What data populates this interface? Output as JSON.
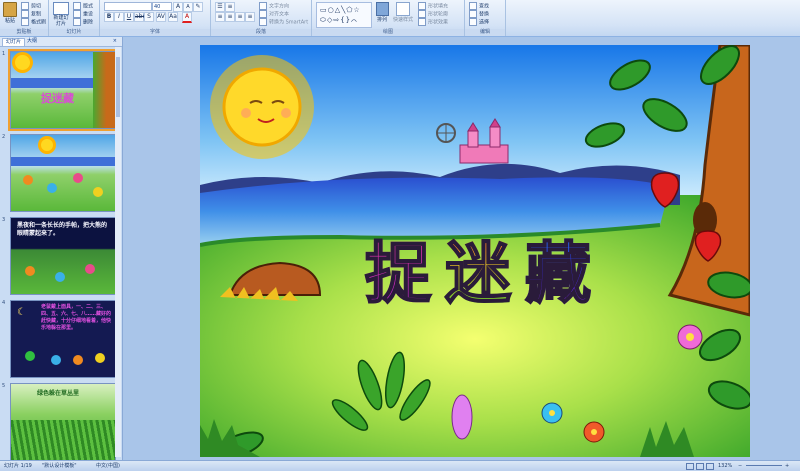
{
  "ribbon": {
    "clipboard": {
      "paste": "粘贴",
      "cut": "剪切",
      "copy": "复制",
      "format_painter": "格式刷",
      "label": "剪贴板"
    },
    "slides": {
      "new_slide": "新建幻灯片",
      "layout": "版式",
      "reset": "重设",
      "delete": "删除",
      "label": "幻灯片"
    },
    "font": {
      "size_value": "40",
      "label": "字体"
    },
    "paragraph": {
      "text_direction": "文字方向",
      "align_text": "对齐文本",
      "convert_smartart": "转换为 SmartArt",
      "label": "段落"
    },
    "drawing": {
      "arrange": "排列",
      "quick_styles": "快速样式",
      "shape_fill": "形状填充",
      "shape_outline": "形状轮廓",
      "shape_effects": "形状效果",
      "label": "绘图"
    },
    "editing": {
      "find": "查找",
      "replace": "替换",
      "select": "选择",
      "label": "编辑"
    }
  },
  "panel": {
    "tabs": [
      "幻灯片",
      "大纲"
    ],
    "close": "×",
    "slides": [
      {
        "num": "1",
        "title": "捉迷藏"
      },
      {
        "num": "2"
      },
      {
        "num": "3",
        "text": "黑夜和一条长长的手帕，把大熊的眼睛蒙起来了。"
      },
      {
        "num": "4",
        "text": "老鼠戴上面具，一、二、三、四、五、六、七、八……藏好的赶快藏，十分仔细地看着，他快乐地躲在那里。"
      },
      {
        "num": "5",
        "text": "绿色躲在草丛里"
      }
    ]
  },
  "slide": {
    "title_chars": [
      "捉",
      "迷",
      "藏"
    ]
  },
  "status": {
    "slide_info": "幻灯片 1/19",
    "theme": "\"默认设计模板\"",
    "language": "中文(中国)",
    "zoom": "132%"
  },
  "colors": {
    "title_char_1": "#e0208a",
    "title_char_2": "#f0c010",
    "title_char_3": "#2e3cff"
  }
}
